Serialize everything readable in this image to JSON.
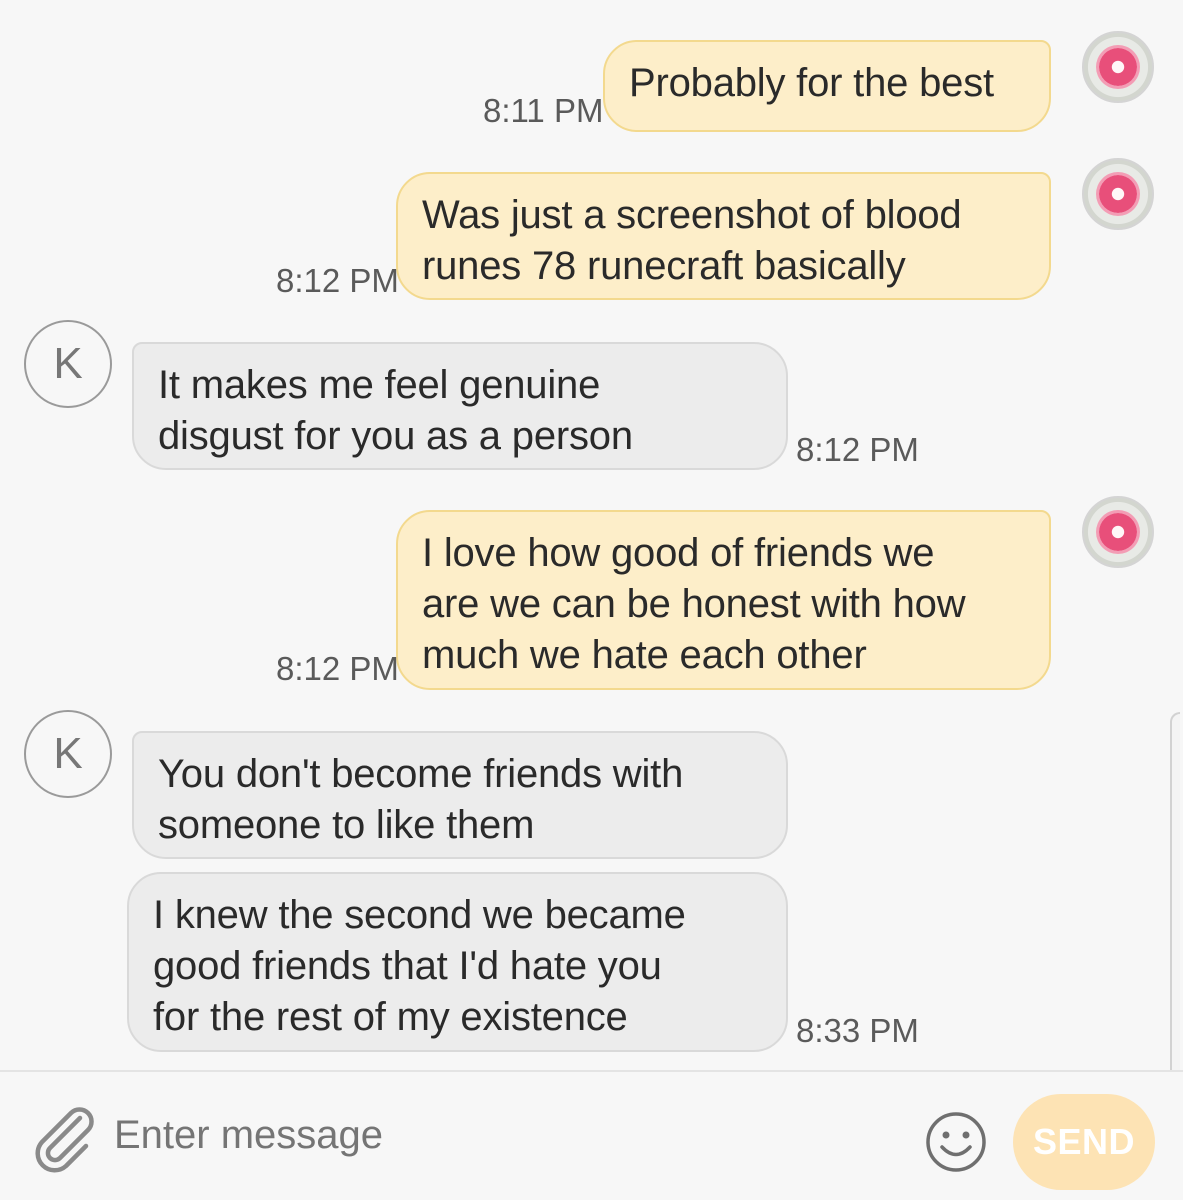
{
  "messages": [
    {
      "direction": "out",
      "lines": [
        "Probably for the best"
      ],
      "time": "8:11 PM"
    },
    {
      "direction": "out",
      "lines": [
        "Was just a screenshot of blood",
        "runes 78 runecraft basically"
      ],
      "time": "8:12 PM"
    },
    {
      "direction": "in",
      "sender_initial": "K",
      "lines": [
        "It makes me feel genuine",
        "disgust for you as a person"
      ],
      "time": "8:12 PM"
    },
    {
      "direction": "out",
      "lines": [
        "I love how good of friends we",
        "are we can be honest with how",
        "much we hate each other"
      ],
      "time": "8:12 PM"
    },
    {
      "direction": "in",
      "sender_initial": "K",
      "lines": [
        "You don't become friends with",
        "someone to like them"
      ]
    },
    {
      "direction": "in",
      "lines": [
        "I knew the second we became",
        "good friends that I'd hate you",
        "for the rest of my existence"
      ],
      "time": "8:33 PM"
    }
  ],
  "compose": {
    "placeholder": "Enter message",
    "send_label": "SEND",
    "attach_icon": "paperclip-icon",
    "emoji_icon": "smiley-icon"
  },
  "colors": {
    "outgoing_bubble": "#fdeec9",
    "incoming_bubble": "#ececec",
    "send_button": "#fde3b4"
  }
}
